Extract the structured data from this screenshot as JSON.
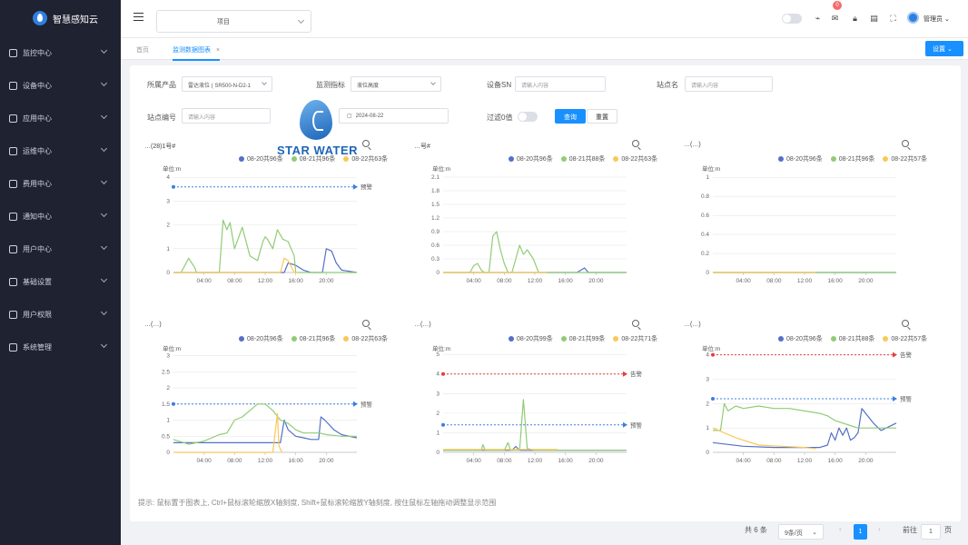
{
  "app": {
    "logo_text": "智慧感知云"
  },
  "sidebar": {
    "items": [
      {
        "label": "监控中心",
        "icon": "monitor-icon"
      },
      {
        "label": "设备中心",
        "icon": "device-icon"
      },
      {
        "label": "应用中心",
        "icon": "app-grid-icon"
      },
      {
        "label": "运维中心",
        "icon": "ops-icon"
      },
      {
        "label": "费用中心",
        "icon": "fee-icon"
      },
      {
        "label": "通知中心",
        "icon": "bell-icon"
      },
      {
        "label": "用户中心",
        "icon": "user-icon"
      },
      {
        "label": "基础设置",
        "icon": "bar-chart-icon"
      },
      {
        "label": "用户权限",
        "icon": "users-icon"
      },
      {
        "label": "系统管理",
        "icon": "gear-icon"
      }
    ]
  },
  "topbar": {
    "project_value": "项目",
    "notification_count": "0",
    "user_name": "管理员"
  },
  "tabs": [
    {
      "label": "首页"
    },
    {
      "label": "监测数据图表"
    }
  ],
  "settings_label": "设置",
  "filters": {
    "product_label": "所属产品",
    "product_value": "雷达液位 ( SR500-N-D2-1",
    "metric_label": "监测指标",
    "metric_value": "液位高度",
    "sn_label": "设备SN",
    "sn_placeholder": "请输入内容",
    "name_label": "站点名",
    "name_placeholder": "请输入内容",
    "code_label": "站点编号",
    "code_placeholder": "请输入内容",
    "date_value": "2024-08-22",
    "filter_zero_label": "过滤0值",
    "query_label": "查询",
    "reset_label": "重置"
  },
  "watermark": {
    "text": "STAR WATER"
  },
  "tip": "提示: 鼠标置于图表上, Ctrl+鼠标滚轮缩放X轴刻度, Shift+鼠标滚轮缩放Y轴刻度, 按住鼠标左轴拖动调整显示范围",
  "pagination": {
    "total": "共 6 条",
    "per_page": "9条/页",
    "current_page": "1",
    "goto_label": "前往",
    "goto_value": "1",
    "page_suffix": "页"
  },
  "colors": {
    "s1": "#5470c6",
    "s2": "#91cc75",
    "s3": "#fac858",
    "blue_line": "#3d7de3",
    "red_line": "#e83c3c"
  },
  "chart_data": [
    {
      "type": "line",
      "title": "…(28)1号#",
      "unit": "单位:m",
      "x_ticks": [
        "04:00",
        "08:00",
        "12:00",
        "16:00",
        "20:00"
      ],
      "yticks": [
        0,
        1,
        2,
        3,
        4
      ],
      "ylim": [
        0,
        4.2
      ],
      "thresholds": [
        {
          "value": 3.6,
          "label": "预警",
          "color": "blue"
        }
      ],
      "series": [
        {
          "name": "08-20共96条",
          "color": "s1",
          "points": [
            [
              0,
              0
            ],
            [
              10,
              0
            ],
            [
              14.5,
              0
            ],
            [
              15,
              0.4
            ],
            [
              16,
              0.3
            ],
            [
              17,
              0.1
            ],
            [
              18,
              0
            ],
            [
              19.5,
              0
            ],
            [
              20,
              1.0
            ],
            [
              20.7,
              0.9
            ],
            [
              21.3,
              0.4
            ],
            [
              22,
              0.1
            ],
            [
              24,
              0
            ]
          ]
        },
        {
          "name": "08-21共96条",
          "color": "s2",
          "points": [
            [
              0,
              0
            ],
            [
              1,
              0
            ],
            [
              2,
              0.6
            ],
            [
              2.8,
              0.2
            ],
            [
              3,
              0
            ],
            [
              6,
              0
            ],
            [
              6.5,
              2.2
            ],
            [
              7,
              1.8
            ],
            [
              7.4,
              2.1
            ],
            [
              8,
              1.0
            ],
            [
              9,
              1.9
            ],
            [
              10,
              0.7
            ],
            [
              11,
              0.5
            ],
            [
              11.7,
              1.3
            ],
            [
              12,
              1.5
            ],
            [
              12.3,
              1.4
            ],
            [
              13,
              1.0
            ],
            [
              13.6,
              1.8
            ],
            [
              14.3,
              1.4
            ],
            [
              15,
              1.3
            ],
            [
              15.8,
              0.7
            ],
            [
              16,
              0
            ],
            [
              24,
              0
            ]
          ]
        },
        {
          "name": "08-22共63条",
          "color": "s3",
          "points": [
            [
              0,
              0
            ],
            [
              14,
              0
            ],
            [
              14.5,
              0.6
            ],
            [
              15,
              0.5
            ],
            [
              15.8,
              0
            ],
            [
              16.4,
              0
            ]
          ]
        }
      ]
    },
    {
      "type": "line",
      "title": "…号#",
      "unit": "单位:m",
      "x_ticks": [
        "04:00",
        "08:00",
        "12:00",
        "16:00",
        "20:00"
      ],
      "yticks": [
        0,
        0.3,
        0.6,
        0.9,
        1.2,
        1.5,
        1.8,
        2.1
      ],
      "ylim": [
        0,
        2.2
      ],
      "thresholds": [],
      "series": [
        {
          "name": "08-20共96条",
          "color": "s1",
          "points": [
            [
              0,
              0
            ],
            [
              17.5,
              0
            ],
            [
              18,
              0.05
            ],
            [
              18.5,
              0.1
            ],
            [
              19,
              0
            ],
            [
              24,
              0
            ]
          ]
        },
        {
          "name": "08-21共88条",
          "color": "s2",
          "points": [
            [
              0,
              0
            ],
            [
              3.5,
              0
            ],
            [
              4,
              0.15
            ],
            [
              4.5,
              0.2
            ],
            [
              5,
              0.05
            ],
            [
              5.4,
              0
            ],
            [
              6,
              0
            ],
            [
              6.5,
              0.8
            ],
            [
              7,
              0.9
            ],
            [
              7.5,
              0.5
            ],
            [
              8,
              0.2
            ],
            [
              8.5,
              0
            ],
            [
              9,
              0
            ],
            [
              9.5,
              0.3
            ],
            [
              10,
              0.6
            ],
            [
              10.5,
              0.4
            ],
            [
              11,
              0.5
            ],
            [
              11.8,
              0.3
            ],
            [
              12.5,
              0
            ],
            [
              24,
              0
            ]
          ]
        },
        {
          "name": "08-22共63条",
          "color": "s3",
          "points": [
            [
              0,
              0
            ],
            [
              13,
              0
            ],
            [
              13.6,
              0
            ]
          ]
        }
      ]
    },
    {
      "type": "line",
      "title": "…(…)",
      "unit": "单位:m",
      "x_ticks": [
        "04:00",
        "08:00",
        "12:00",
        "16:00",
        "20:00"
      ],
      "yticks": [
        0,
        0.2,
        0.4,
        0.6,
        0.8,
        1
      ],
      "ylim": [
        0,
        1.05
      ],
      "thresholds": [],
      "series": [
        {
          "name": "08-20共96条",
          "color": "s1",
          "points": [
            [
              0,
              0
            ],
            [
              24,
              0
            ]
          ]
        },
        {
          "name": "08-21共96条",
          "color": "s2",
          "points": [
            [
              0,
              0
            ],
            [
              24,
              0
            ]
          ]
        },
        {
          "name": "08-22共57条",
          "color": "s3",
          "points": [
            [
              0,
              0
            ],
            [
              13.5,
              0
            ]
          ]
        }
      ]
    },
    {
      "type": "line",
      "title": "…(…)",
      "unit": "单位:m",
      "x_ticks": [
        "04:00",
        "08:00",
        "12:00",
        "16:00",
        "20:00"
      ],
      "yticks": [
        0,
        0.5,
        1,
        1.5,
        2,
        2.5,
        3
      ],
      "ylim": [
        0,
        3.1
      ],
      "thresholds": [
        {
          "value": 1.5,
          "label": "预警",
          "color": "blue"
        }
      ],
      "series": [
        {
          "name": "08-20共96条",
          "color": "s1",
          "points": [
            [
              0,
              0.3
            ],
            [
              14,
              0.3
            ],
            [
              14.5,
              1.0
            ],
            [
              15,
              0.7
            ],
            [
              16,
              0.5
            ],
            [
              17,
              0.45
            ],
            [
              18,
              0.4
            ],
            [
              19,
              0.4
            ],
            [
              19.3,
              1.1
            ],
            [
              19.8,
              1.0
            ],
            [
              21,
              0.7
            ],
            [
              22,
              0.55
            ],
            [
              24,
              0.45
            ]
          ]
        },
        {
          "name": "08-21共96条",
          "color": "s2",
          "points": [
            [
              0,
              0.4
            ],
            [
              2,
              0.25
            ],
            [
              4,
              0.35
            ],
            [
              6,
              0.55
            ],
            [
              7,
              0.6
            ],
            [
              8,
              1.0
            ],
            [
              9,
              1.1
            ],
            [
              10,
              1.3
            ],
            [
              11,
              1.5
            ],
            [
              12,
              1.5
            ],
            [
              13,
              1.3
            ],
            [
              14,
              1.0
            ],
            [
              15,
              0.9
            ],
            [
              16,
              0.7
            ],
            [
              17,
              0.6
            ],
            [
              18,
              0.6
            ],
            [
              19,
              0.6
            ],
            [
              20,
              0.55
            ],
            [
              22,
              0.5
            ],
            [
              24,
              0.5
            ]
          ]
        },
        {
          "name": "08-22共63条",
          "color": "s3",
          "points": [
            [
              0,
              0
            ],
            [
              13,
              0
            ],
            [
              13.6,
              1.2
            ],
            [
              13.8,
              0.2
            ],
            [
              14.2,
              0
            ]
          ]
        }
      ]
    },
    {
      "type": "line",
      "title": "…(…)",
      "unit": "单位:m",
      "x_ticks": [
        "04:00",
        "08:00",
        "12:00",
        "16:00",
        "20:00"
      ],
      "yticks": [
        0,
        1,
        2,
        3,
        4,
        5
      ],
      "ylim": [
        0,
        5.1
      ],
      "thresholds": [
        {
          "value": 4,
          "label": "告警",
          "color": "red"
        },
        {
          "value": 1.4,
          "label": "预警",
          "color": "blue"
        }
      ],
      "series": [
        {
          "name": "08-20共99条",
          "color": "s1",
          "points": [
            [
              0,
              0.1
            ],
            [
              9,
              0.1
            ],
            [
              9.5,
              0.3
            ],
            [
              10,
              0.1
            ],
            [
              24,
              0.1
            ]
          ]
        },
        {
          "name": "08-21共99条",
          "color": "s2",
          "points": [
            [
              0,
              0.1
            ],
            [
              5,
              0.1
            ],
            [
              5.2,
              0.4
            ],
            [
              5.5,
              0.1
            ],
            [
              8,
              0.1
            ],
            [
              8.5,
              0.5
            ],
            [
              8.8,
              0.1
            ],
            [
              10,
              0.1
            ],
            [
              10.5,
              2.7
            ],
            [
              11,
              0.2
            ],
            [
              12,
              0.1
            ],
            [
              24,
              0.1
            ]
          ]
        },
        {
          "name": "08-22共71条",
          "color": "s3",
          "points": [
            [
              0,
              0.15
            ],
            [
              15,
              0.15
            ]
          ]
        }
      ]
    },
    {
      "type": "line",
      "title": "…(…)",
      "unit": "单位:m",
      "x_ticks": [
        "04:00",
        "08:00",
        "12:00",
        "16:00",
        "20:00"
      ],
      "yticks": [
        0,
        1,
        2,
        3,
        4
      ],
      "ylim": [
        0,
        4.1
      ],
      "thresholds": [
        {
          "value": 4,
          "label": "告警",
          "color": "red"
        },
        {
          "value": 2.2,
          "label": "预警",
          "color": "blue"
        }
      ],
      "series": [
        {
          "name": "08-20共96条",
          "color": "s1",
          "points": [
            [
              0,
              0.4
            ],
            [
              4,
              0.25
            ],
            [
              8,
              0.2
            ],
            [
              12,
              0.2
            ],
            [
              14,
              0.2
            ],
            [
              15,
              0.3
            ],
            [
              15.5,
              0.8
            ],
            [
              16,
              0.5
            ],
            [
              16.5,
              1.0
            ],
            [
              17,
              0.7
            ],
            [
              17.5,
              1.0
            ],
            [
              18,
              0.5
            ],
            [
              18.5,
              0.6
            ],
            [
              19,
              0.8
            ],
            [
              19.5,
              1.8
            ],
            [
              20,
              1.6
            ],
            [
              21,
              1.2
            ],
            [
              22,
              0.9
            ],
            [
              24,
              1.2
            ]
          ]
        },
        {
          "name": "08-21共88条",
          "color": "s2",
          "points": [
            [
              0,
              0.9
            ],
            [
              1,
              0.9
            ],
            [
              1.5,
              2.0
            ],
            [
              2,
              1.7
            ],
            [
              3,
              1.9
            ],
            [
              4,
              1.8
            ],
            [
              6,
              1.9
            ],
            [
              8,
              1.8
            ],
            [
              10,
              1.8
            ],
            [
              12,
              1.7
            ],
            [
              14,
              1.6
            ],
            [
              15,
              1.5
            ],
            [
              16,
              1.3
            ],
            [
              17,
              1.2
            ],
            [
              18,
              1.1
            ],
            [
              19,
              1.0
            ],
            [
              20,
              1.0
            ],
            [
              22,
              1.0
            ],
            [
              24,
              1.0
            ]
          ]
        },
        {
          "name": "08-22共57条",
          "color": "s3",
          "points": [
            [
              0,
              1.0
            ],
            [
              3,
              0.6
            ],
            [
              6,
              0.3
            ],
            [
              9,
              0.25
            ],
            [
              12,
              0.2
            ],
            [
              13.5,
              0.15
            ]
          ]
        }
      ]
    }
  ]
}
